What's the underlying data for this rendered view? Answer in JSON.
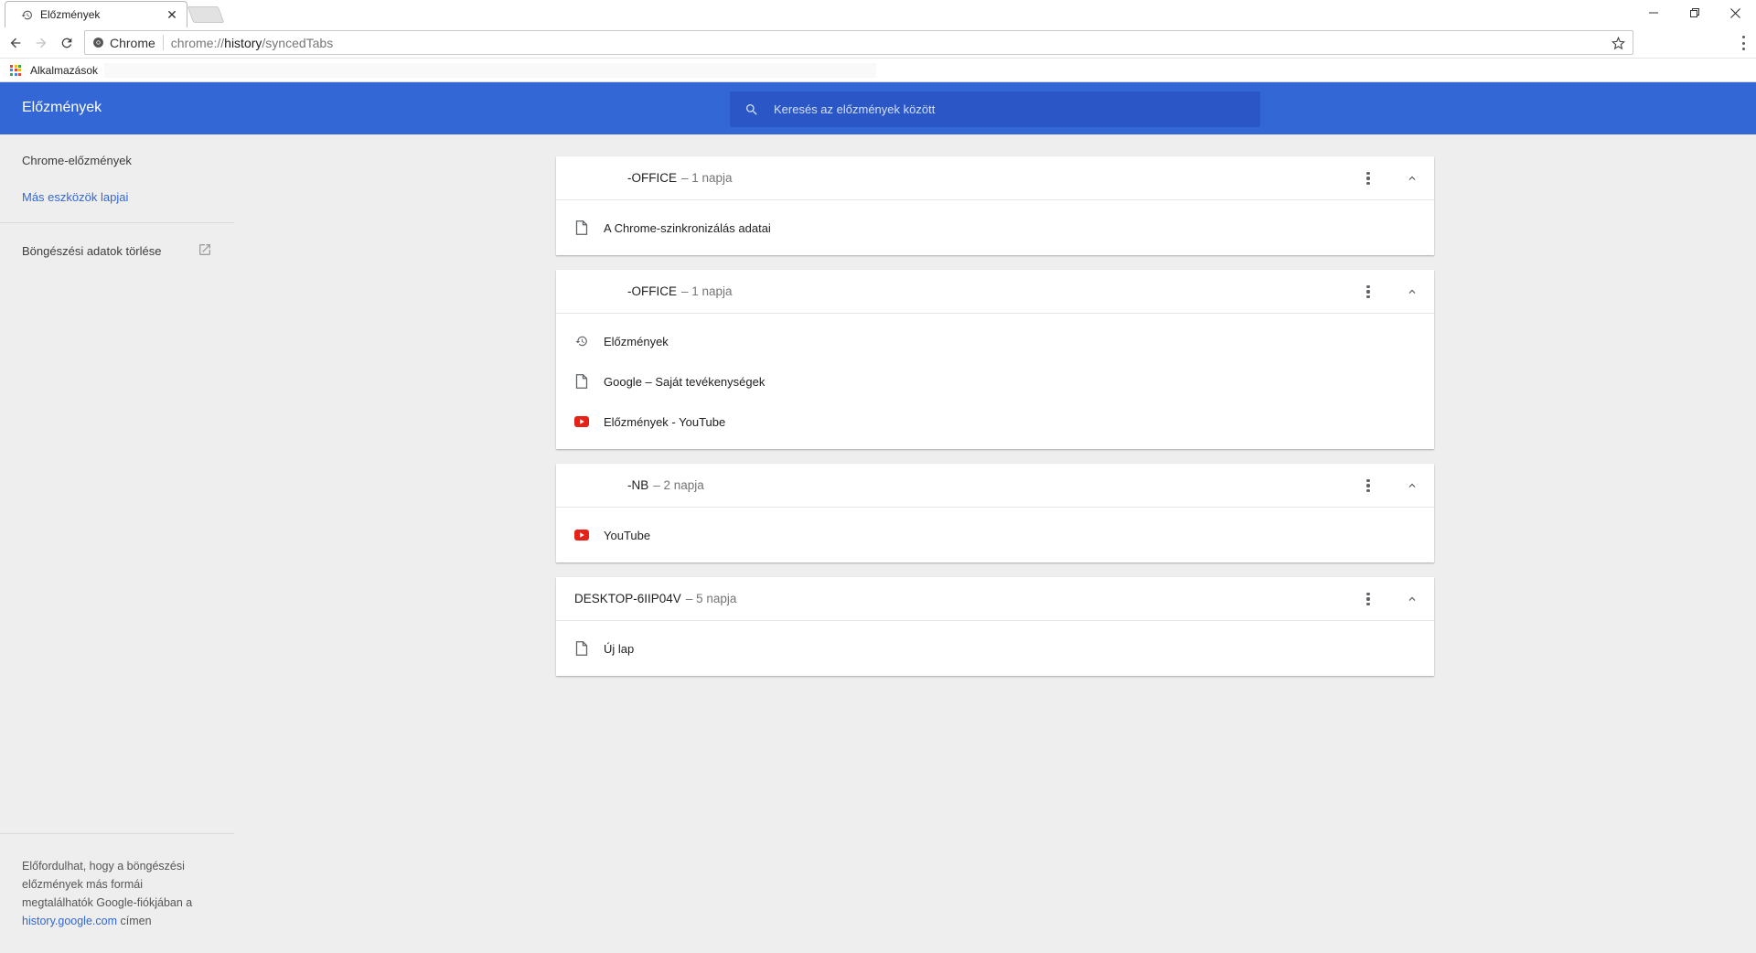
{
  "window": {
    "tab_title": "Előzmények",
    "tab_close": "✕"
  },
  "toolbar": {
    "omnibox_secure_label": "Chrome",
    "url_scheme": "chrome://",
    "url_host": "history",
    "url_path": "/syncedTabs"
  },
  "bookmarks": {
    "apps_label": "Alkalmazások"
  },
  "header": {
    "title": "Előzmények",
    "search_placeholder": "Keresés az előzmények között"
  },
  "sidebar": {
    "items": [
      {
        "label": "Chrome-előzmények",
        "active": false
      },
      {
        "label": "Más eszközök lapjai",
        "active": true
      }
    ],
    "clear_label": "Böngészési adatok törlése",
    "footer_text_1": "Előfordulhat, hogy a böngészési előzmények más formái megtalálhatók Google-fiókjában a",
    "footer_link": "history.google.com",
    "footer_text_2": "címen"
  },
  "devices": [
    {
      "name": "-OFFICE",
      "time": "– 1 napja",
      "tabs": [
        {
          "title": "A Chrome-szinkronizálás adatai",
          "icon": "page-icon"
        }
      ]
    },
    {
      "name": "-OFFICE",
      "time": "– 1 napja",
      "tabs": [
        {
          "title": "Előzmények",
          "icon": "history-icon"
        },
        {
          "title": "Google – Saját tevékenységek",
          "icon": "page-icon"
        },
        {
          "title": "Előzmények - YouTube",
          "icon": "youtube-icon"
        }
      ]
    },
    {
      "name": "-NB",
      "time": "– 2 napja",
      "tabs": [
        {
          "title": "YouTube",
          "icon": "youtube-icon"
        }
      ]
    },
    {
      "name": "DESKTOP-6IIP04V",
      "time": "– 5 napja",
      "tabs": [
        {
          "title": "Új lap",
          "icon": "page-icon"
        }
      ]
    }
  ],
  "colors": {
    "header_blue": "#3367d6",
    "search_blue": "#2a56c6",
    "youtube_red": "#e62117",
    "link_blue": "#3367d6"
  }
}
